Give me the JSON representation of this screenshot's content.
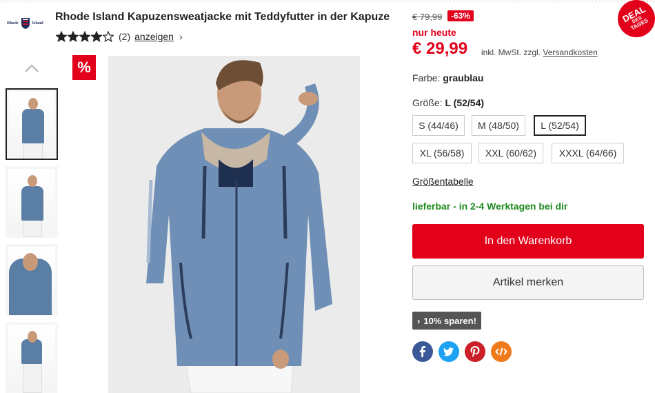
{
  "brand": {
    "logo_left": "Rhode",
    "logo_right": "Island"
  },
  "product": {
    "title": "Rhode Island Kapuzensweatjacke mit Teddyfutter in der Kapuze",
    "rating_stars": 4,
    "rating_max": 5,
    "rating_count": "(2)",
    "rating_link": "anzeigen",
    "rating_chevron": "›"
  },
  "gallery": {
    "discount_badge": "%",
    "up_arrow_icon": "chevron-up-icon",
    "thumbnails": 4
  },
  "pricing": {
    "old_price": "€ 79,99",
    "discount": "-63%",
    "today_label": "nur heute",
    "price": "€ 29,99",
    "tax_text": "inkl. MwSt. zzgl.",
    "shipping_link": "Versandkosten"
  },
  "deal_badge": {
    "line1": "DEAL",
    "line2": "DES",
    "line3": "TAGES"
  },
  "color": {
    "label": "Farbe:",
    "value": "graublau"
  },
  "size": {
    "label": "Größe:",
    "value": "L (52/54)",
    "options": [
      "S (44/46)",
      "M (48/50)",
      "L (52/54)",
      "XL (56/58)",
      "XXL (60/62)",
      "XXXL (64/66)"
    ],
    "selected_index": 2
  },
  "size_table_link": "Größentabelle",
  "availability": "lieferbar - in 2-4 Werktagen bei dir",
  "buttons": {
    "cart": "In den Warenkorb",
    "save": "Artikel merken"
  },
  "promo": {
    "chevron": "›",
    "label": "10% sparen!"
  },
  "social": [
    {
      "name": "facebook",
      "glyph": "f",
      "color": "#3b5998"
    },
    {
      "name": "twitter",
      "glyph": "t",
      "color": "#1da1f2"
    },
    {
      "name": "pinterest",
      "glyph": "P",
      "color": "#cb2027"
    },
    {
      "name": "embed",
      "glyph": "</>",
      "color": "#f07a1a"
    }
  ],
  "colors": {
    "accent": "#e2001a",
    "stock": "#1f8a1f",
    "promo_bg": "#555555"
  }
}
